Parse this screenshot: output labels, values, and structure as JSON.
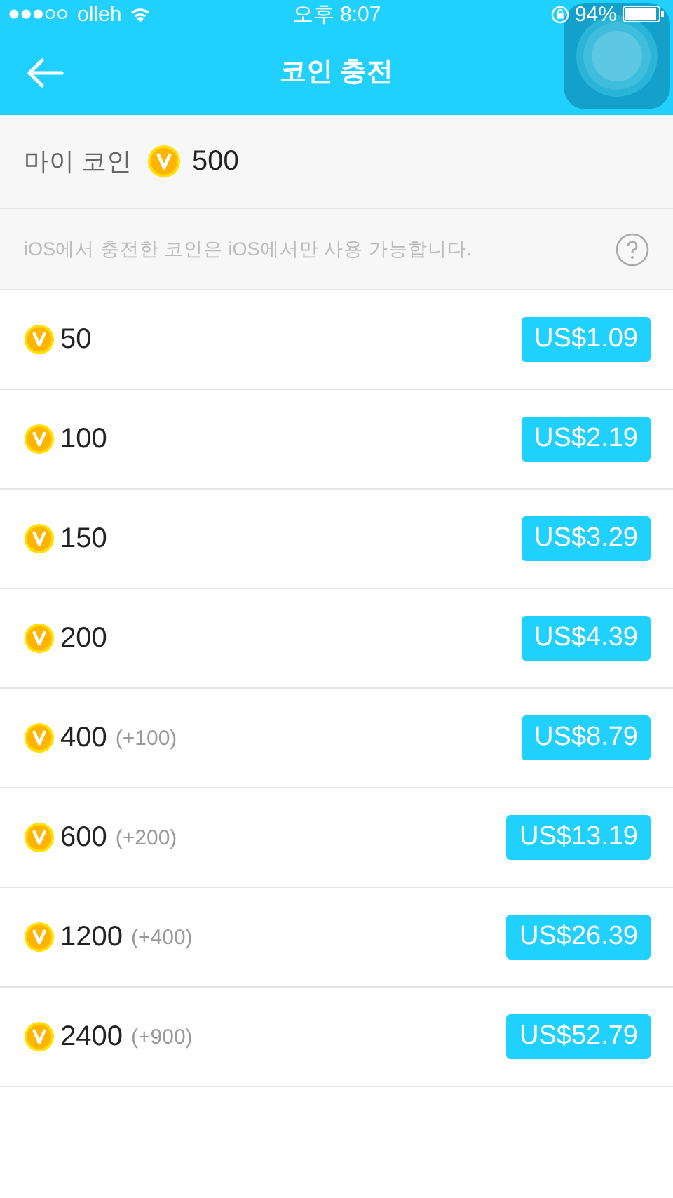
{
  "status_bar": {
    "carrier": "olleh",
    "time": "오후 8:07",
    "battery": "94%"
  },
  "nav": {
    "title": "코인 충전"
  },
  "my_coin": {
    "label": "마이 코인",
    "amount": "500"
  },
  "notice": {
    "text": "iOS에서 충전한 코인은 iOS에서만 사용 가능합니다."
  },
  "packages": [
    {
      "amount": "50",
      "price": "US$1.09"
    },
    {
      "amount": "100",
      "price": "US$2.19"
    },
    {
      "amount": "150",
      "price": "US$3.29"
    },
    {
      "amount": "200",
      "price": "US$4.39"
    },
    {
      "amount": "400",
      "bonus": "(+100)",
      "price": "US$8.79"
    },
    {
      "amount": "600",
      "bonus": "(+200)",
      "price": "US$13.19"
    },
    {
      "amount": "1200",
      "bonus": "(+400)",
      "price": "US$26.39"
    },
    {
      "amount": "2400",
      "bonus": "(+900)",
      "price": "US$52.79"
    }
  ]
}
